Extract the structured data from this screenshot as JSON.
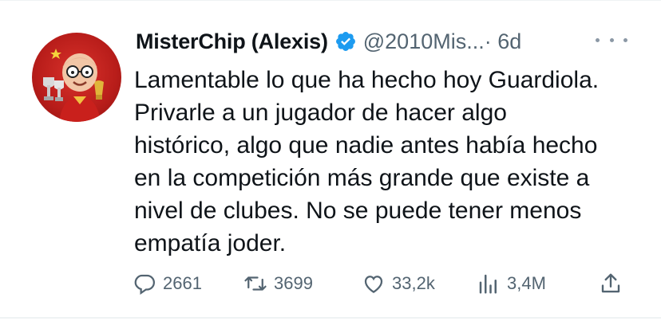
{
  "tweet": {
    "display_name": "MisterChip (Alexis)",
    "handle": "@2010Mis...",
    "time": "· 6d",
    "text_lines": [
      "Lamentable lo que ha hecho hoy Guardiola.",
      "Privarle a un jugador de hacer algo",
      "histórico, algo que nadie antes había hecho",
      "en la competición más grande que existe a",
      "nivel de clubes. No se puede tener menos",
      "empatía joder."
    ]
  },
  "actions": {
    "replies": "2661",
    "retweets": "3699",
    "likes": "33,2k",
    "views": "3,4M"
  },
  "icons": {
    "reply": "reply-icon",
    "retweet": "retweet-icon",
    "like": "heart-icon",
    "views": "views-chart-icon",
    "share": "share-icon",
    "verified": "verified-badge-icon",
    "more": "more-options-icon"
  },
  "colors": {
    "verified": "#1d9bf0",
    "secondary_text": "#536471",
    "text": "#0f1419"
  }
}
